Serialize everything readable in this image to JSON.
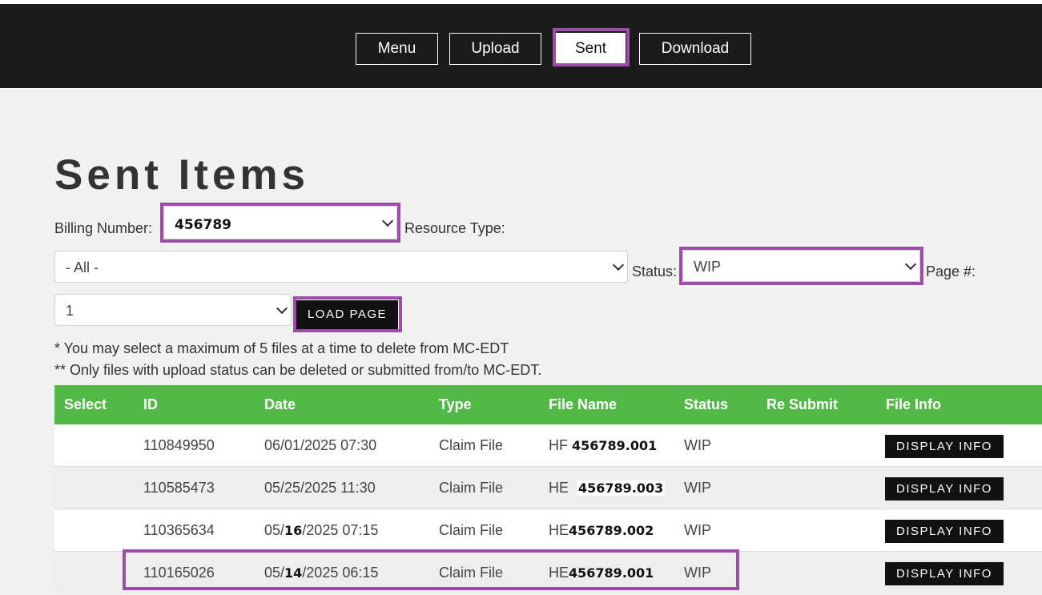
{
  "nav": {
    "items": [
      {
        "label": "Menu"
      },
      {
        "label": "Upload"
      },
      {
        "label": "Sent"
      },
      {
        "label": "Download"
      }
    ],
    "active": "Sent"
  },
  "page": {
    "title": "Sent Items"
  },
  "filters": {
    "billing_label": "Billing Number:",
    "billing_value": "456789",
    "resource_label": "Resource Type:",
    "resource_value": "- All -",
    "status_label": "Status:",
    "status_value": "WIP",
    "page_label": "Page #:",
    "page_value": "1",
    "load_button": "LOAD PAGE"
  },
  "notes": {
    "note1": "* You may select a maximum of 5 files at a time to delete from MC-EDT",
    "note2": "** Only files with upload status can be deleted or submitted from/to MC-EDT."
  },
  "table": {
    "headers": {
      "select": "Select",
      "id": "ID",
      "date": "Date",
      "type": "Type",
      "file_name": "File Name",
      "status": "Status",
      "resubmit": "Re Submit",
      "file_info": "File Info"
    },
    "rows": [
      {
        "id": "110849950",
        "date_prefix": "06/01/2025 07:30",
        "date_bold": "",
        "date_suffix": "",
        "type": "Claim File",
        "file_prefix": "HF ",
        "file_bold": "456789.001",
        "status": "WIP",
        "info": "DISPLAY INFO"
      },
      {
        "id": "110585473",
        "date_prefix": "05/25/2025 11:30",
        "date_bold": "",
        "date_suffix": "",
        "type": "Claim File",
        "file_prefix": "HE",
        "file_bold": "456789.003",
        "status": "WIP",
        "info": "DISPLAY INFO"
      },
      {
        "id": "110365634",
        "date_prefix": "05/",
        "date_bold": "16",
        "date_suffix": "/2025 07:15",
        "type": "Claim File",
        "file_prefix": "HE",
        "file_bold": "456789.002",
        "status": "WIP",
        "info": "DISPLAY INFO"
      },
      {
        "id": "110165026",
        "date_prefix": "05/",
        "date_bold": "14",
        "date_suffix": "/2025 06:15",
        "type": "Claim File",
        "file_prefix": "HE",
        "file_bold": "456789.001",
        "status": "WIP",
        "info": "DISPLAY INFO"
      }
    ]
  },
  "colors": {
    "header_bg": "#1b1b1b",
    "table_header": "#52b948",
    "highlight": "#9a4ea6"
  }
}
